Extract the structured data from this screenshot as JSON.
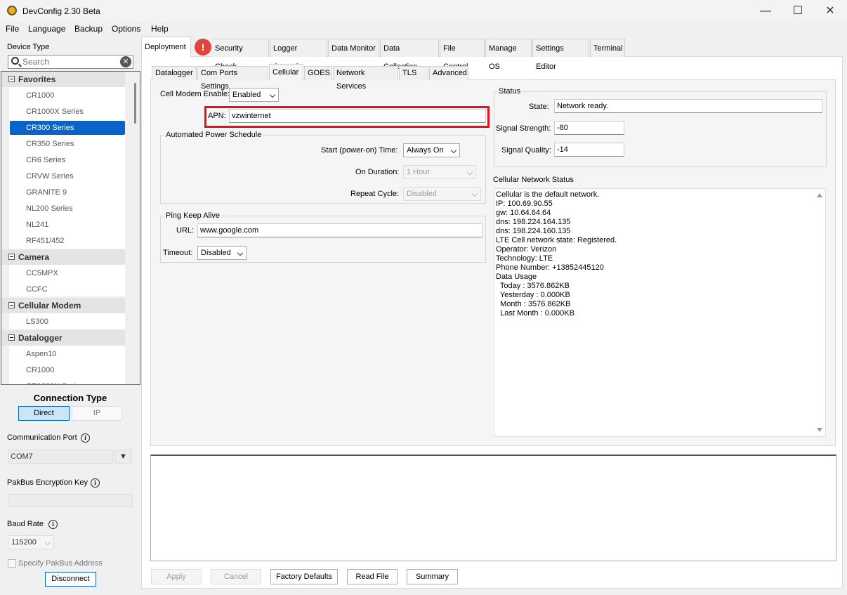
{
  "window": {
    "title": "DevConfig 2.30 Beta",
    "controls": {
      "minimize": "—",
      "maximize": "☐",
      "close": "✕"
    }
  },
  "menu": [
    "File",
    "Language",
    "Backup",
    "Options",
    "Help"
  ],
  "sidebar": {
    "device_type_label": "Device Type",
    "search_placeholder": "Search",
    "groups": [
      {
        "label": "Favorites",
        "items": [
          "CR1000",
          "CR1000X Series",
          "CR300 Series",
          "CR350 Series",
          "CR6 Series",
          "CRVW Series",
          "GRANITE 9",
          "NL200 Series",
          "NL241",
          "RF451/452"
        ]
      },
      {
        "label": "Camera",
        "items": [
          "CC5MPX",
          "CCFC"
        ]
      },
      {
        "label": "Cellular Modem",
        "items": [
          "LS300"
        ]
      },
      {
        "label": "Datalogger",
        "items": [
          "Aspen10",
          "CR1000",
          "CR1000X Series"
        ]
      }
    ],
    "selected_item": "CR300 Series",
    "connection_type_label": "Connection Type",
    "connection_options": [
      "Direct",
      "IP"
    ],
    "selected_connection": "Direct",
    "comm_port_label": "Communication Port",
    "comm_port_value": "COM7",
    "pakbus_key_label": "PakBus Encryption Key",
    "pakbus_key_value": "",
    "baud_rate_label": "Baud Rate",
    "baud_rate_value": "115200",
    "specify_pakbus_label": "Specify PakBus Address",
    "disconnect_label": "Disconnect"
  },
  "main_tabs": [
    "Deployment",
    "Security Check",
    "Logger Control",
    "Data Monitor",
    "Data Collection",
    "File Control",
    "Manage OS",
    "Settings Editor",
    "Terminal"
  ],
  "alert_glyph": "!",
  "sub_tabs": [
    "Datalogger",
    "Com Ports Settings",
    "Cellular",
    "GOES",
    "Network Services",
    "TLS",
    "Advanced"
  ],
  "cellular": {
    "modem_enable_label": "Cell Modem Enable:",
    "modem_enable_value": "Enabled",
    "apn_label": "APN:",
    "apn_value": "vzwinternet",
    "power_schedule_title": "Automated Power Schedule",
    "start_time_label": "Start (power-on) Time:",
    "start_time_value": "Always On",
    "on_duration_label": "On Duration:",
    "on_duration_value": "1 Hour",
    "repeat_cycle_label": "Repeat Cycle:",
    "repeat_cycle_value": "Disabled",
    "ping_title": "Ping Keep Alive",
    "url_label": "URL:",
    "url_value": "www.google.com",
    "timeout_label": "Timeout:",
    "timeout_value": "Disabled"
  },
  "status": {
    "title": "Status",
    "state_label": "State:",
    "state_value": "Network ready.",
    "signal_strength_label": "Signal Strength:",
    "signal_strength_value": "-80",
    "signal_quality_label": "Signal Quality:",
    "signal_quality_value": "-14",
    "network_status_title": "Cellular Network Status",
    "network_status_text": "Cellular is the default network.\nIP: 100.69.90.55\ngw: 10.64.64.64\ndns: 198.224.164.135\ndns: 198.224.160.135\nLTE Cell network state: Registered.\nOperator: Verizon\nTechnology: LTE\nPhone Number: +13852445120\nData Usage\n  Today : 3576.862KB\n  Yesterday : 0.000KB\n  Month : 3576.862KB\n  Last Month : 0.000KB"
  },
  "footer_buttons": [
    "Apply",
    "Cancel",
    "Factory Defaults",
    "Read File",
    "Summary"
  ]
}
